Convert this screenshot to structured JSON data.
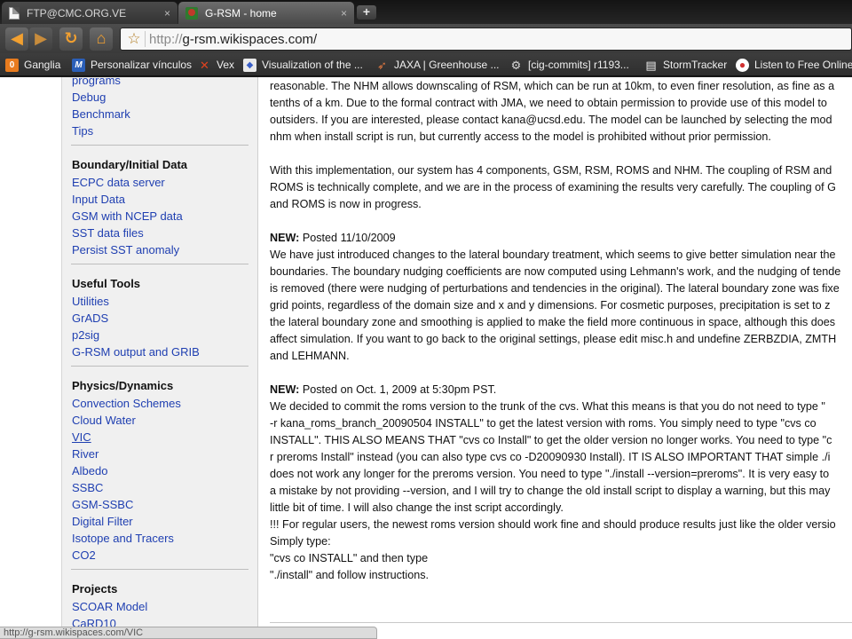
{
  "browser": {
    "tabs": [
      {
        "label": "FTP@CMC.ORG.VE",
        "close": "×"
      },
      {
        "label": "G-RSM - home",
        "close": "×"
      }
    ],
    "new_tab": "+",
    "url_scheme": "http://",
    "url_rest": "g-rsm.wikispaces.com/",
    "icons": {
      "back": "◀",
      "forward": "▶",
      "reload": "↻",
      "home": "⌂",
      "star": "☆"
    },
    "bookmarks": [
      {
        "label": "Ganglia",
        "icon": "0",
        "color": "#e87b1e"
      },
      {
        "label": "Personalizar vínculos",
        "icon": "M",
        "color": "#2b5fb8"
      },
      {
        "label": "Vex",
        "icon": "✕",
        "color": "#d9381e"
      },
      {
        "label": "Visualization of the ...",
        "icon": "◆",
        "color": "#4a6fd1"
      },
      {
        "label": "JAXA | Greenhouse ...",
        "icon": "➶",
        "color": "#c06030"
      },
      {
        "label": "[cig-commits] r1193...",
        "icon": "⚙",
        "color": "#8c8c8c"
      },
      {
        "label": "StormTracker",
        "icon": "▤",
        "color": "#e8e8e8"
      },
      {
        "label": "Listen to Free Online...",
        "icon": "●",
        "color": "#d03030"
      }
    ]
  },
  "sidebar": {
    "group0": [
      "programs",
      "Debug",
      "Benchmark",
      "Tips"
    ],
    "boundary": {
      "title": "Boundary/Initial Data",
      "items": [
        "ECPC data server",
        "Input Data",
        "GSM with NCEP data",
        "SST data files",
        "Persist SST anomaly"
      ]
    },
    "tools": {
      "title": "Useful Tools",
      "items": [
        "Utilities",
        "GrADS",
        "p2sig",
        "G-RSM output and GRIB"
      ]
    },
    "physics": {
      "title": "Physics/Dynamics",
      "items": [
        "Convection Schemes",
        "Cloud Water",
        "VIC",
        "River",
        "Albedo",
        "SSBC",
        "GSM-SSBC",
        "Digital Filter",
        "Isotope and Tracers",
        "CO2"
      ]
    },
    "projects": {
      "title": "Projects",
      "items": [
        "SCOAR Model",
        "CaRD10"
      ]
    }
  },
  "content": {
    "p1": [
      "reasonable. The NHM allows downscaling of RSM, which can be run at 10km, to even finer resolution, as fine as a",
      "tenths of a km. Due to the formal contract with JMA, we need to obtain permission to provide use of this model to",
      "outsiders. If you are interested, please contact kana@ucsd.edu. The model can be launched by selecting the mod",
      "nhm when install script is run, but currently access to the model is prohibited without prior permission."
    ],
    "p2": [
      "With this implementation, our system has 4 components, GSM, RSM, ROMS and NHM. The coupling of RSM and",
      "ROMS is technically complete, and we are in the process of examining the results very carefully. The coupling of G",
      "and ROMS is now in progress."
    ],
    "news1_label": "NEW:",
    "news1_date": " Posted 11/10/2009",
    "news1": [
      "We have just introduced changes to the lateral boundary treatment, which seems to give better simulation near the",
      "boundaries. The boundary nudging coefficients are now computed using Lehmann's work, and the nudging of tende",
      "is removed (there were nudging of perturbations and tendencies in the original). The lateral boundary zone was fixe",
      "grid points, regardless of the domain size and x and y dimensions. For cosmetic purposes, precipitation is set to z",
      "the lateral boundary zone and smoothing is applied to make the field more continuous in space, although this does",
      "affect simulation. If you want to go back to the original settings, please edit misc.h and undefine ZERBZDIA, ZMTH",
      "and LEHMANN."
    ],
    "news2_label": "NEW:",
    "news2_date": " Posted on Oct. 1, 2009 at 5:30pm PST.",
    "news2": [
      "We decided to commit the roms version to the trunk of the cvs. What this means is that you do not need to type \"",
      "-r kana_roms_branch_20090504 INSTALL\" to get the latest version with roms. You simply need to type \"cvs co",
      "INSTALL\". THIS ALSO MEANS THAT \"cvs co Install\" to get the older version no longer works. You need to type \"c",
      "r preroms Install\" instead (you can also type cvs co -D20090930 Install). IT IS ALSO IMPORTANT THAT simple ./i",
      "does not work any longer for the preroms version. You need to type \"./install --version=preroms\". It is very easy to",
      "a mistake by not providing --version, and I will try to change the old install script to display a warning, but this may",
      "little bit of time. I will also change the inst script accordingly.",
      "!!! For regular users, the newest roms version should work fine and should produce results just like the older versio",
      "Simply type:",
      "\"cvs co INSTALL\" and then type",
      "\"./install\" and follow instructions."
    ]
  },
  "status": "http://g-rsm.wikispaces.com/VIC"
}
